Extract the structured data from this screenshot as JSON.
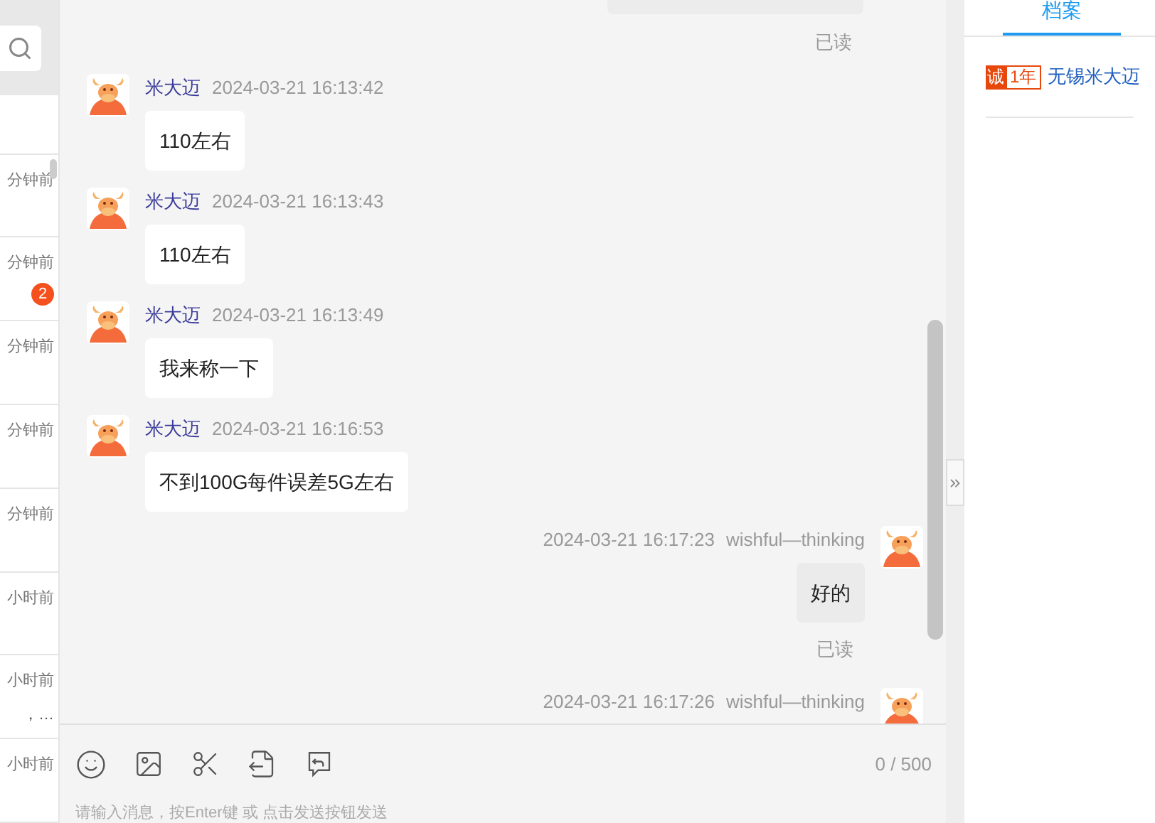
{
  "sidebar": {
    "items": [
      {
        "time": "分钟前"
      },
      {
        "time": "分钟前",
        "badge": "2"
      },
      {
        "time": "分钟前"
      },
      {
        "time": "分钟前"
      },
      {
        "time": "分钟前"
      },
      {
        "time": "小时前"
      },
      {
        "time": "小时前",
        "preview": "，…"
      },
      {
        "time": "小时前"
      }
    ]
  },
  "chat": {
    "messages": [
      {
        "kind": "partial",
        "outgoing": true,
        "status": "已读"
      },
      {
        "kind": "message",
        "outgoing": false,
        "sender": "米大迈",
        "time": "2024-03-21 16:13:42",
        "text": "110左右"
      },
      {
        "kind": "message",
        "outgoing": false,
        "sender": "米大迈",
        "time": "2024-03-21 16:13:43",
        "text": "110左右"
      },
      {
        "kind": "message",
        "outgoing": false,
        "sender": "米大迈",
        "time": "2024-03-21 16:13:49",
        "text": "我来称一下"
      },
      {
        "kind": "message",
        "outgoing": false,
        "sender": "米大迈",
        "time": "2024-03-21 16:16:53",
        "text": "不到100G每件误差5G左右"
      },
      {
        "kind": "message",
        "outgoing": true,
        "sender": "wishful—thinking",
        "time": "2024-03-21 16:17:23",
        "text": "好的",
        "status": "已读"
      },
      {
        "kind": "cut",
        "outgoing": true,
        "sender": "wishful—thinking",
        "time": "2024-03-21 16:17:26"
      }
    ]
  },
  "composer": {
    "count": "0 / 500",
    "placeholder": "请输入消息，按Enter键 或 点击发送按钮发送"
  },
  "profile": {
    "tabs": [
      {
        "label": "档案",
        "selected": true
      }
    ],
    "badge_main": "诚",
    "badge_years": "1年",
    "company": "无锡米大迈"
  }
}
